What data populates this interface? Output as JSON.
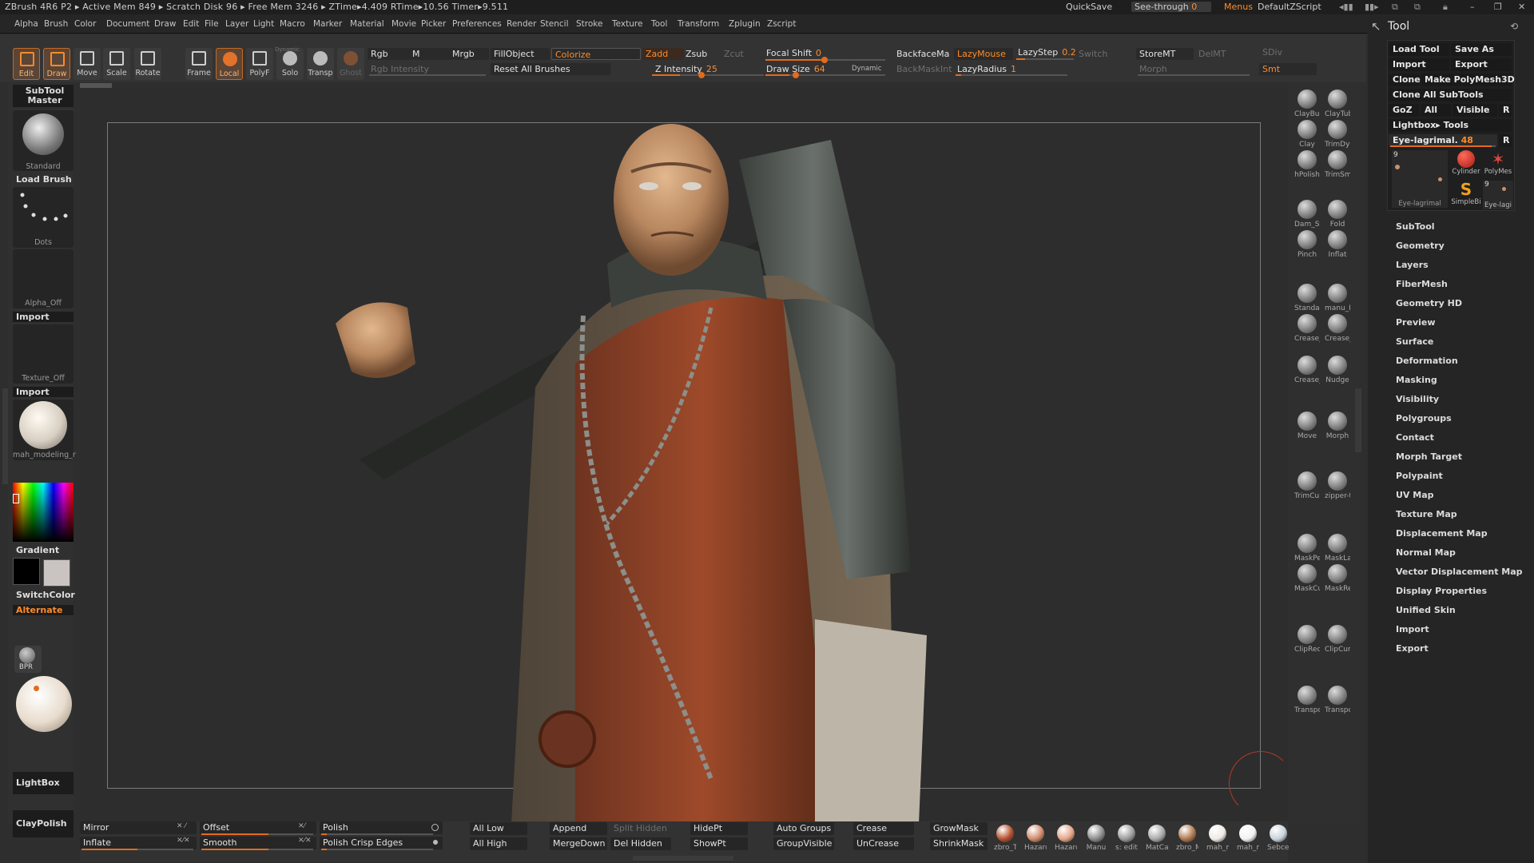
{
  "titlebar": {
    "title": "ZBrush 4R6 P2 ▸ Active Mem 849 ▸ Scratch Disk 96 ▸ Free Mem 3246 ▸ ZTime▸4.409 RTime▸10.56 Timer▸9.511",
    "quicksave": "QuickSave",
    "seethrough": "See-through",
    "seethrough_val": "0",
    "menus": "Menus",
    "script": "DefaultZScript"
  },
  "menubar": [
    "Alpha",
    "Brush",
    "Color",
    "Document",
    "Draw",
    "Edit",
    "File",
    "Layer",
    "Light",
    "Macro",
    "Marker",
    "Material",
    "Movie",
    "Picker",
    "Preferences",
    "Render",
    "Stencil",
    "Stroke",
    "Texture",
    "Tool",
    "Transform",
    "Zplugin",
    "Zscript"
  ],
  "topshelf": {
    "edit": "Edit",
    "draw": "Draw",
    "move": "Move",
    "scale": "Scale",
    "rotate": "Rotate",
    "frame": "Frame",
    "local": "Local",
    "polyf": "PolyF",
    "solo": "Solo",
    "transp": "Transp",
    "ghost": "Ghost",
    "dynamic_small": "Dynamic",
    "rgb": "Rgb",
    "m": "M",
    "mrgb": "Mrgb",
    "rgb_intensity": "Rgb Intensity",
    "fillobject": "FillObject",
    "colorize": "Colorize",
    "reset_brushes": "Reset All Brushes",
    "zadd": "Zadd",
    "zsub": "Zsub",
    "zcut": "Zcut",
    "z_intensity": "Z Intensity",
    "z_intensity_val": "25",
    "focal_shift": "Focal Shift",
    "focal_shift_val": "0",
    "draw_size": "Draw Size",
    "draw_size_val": "64",
    "dynamic": "Dynamic",
    "backface": "BackfaceMa",
    "backmask": "BackMaskInt",
    "lazymouse": "LazyMouse",
    "lazystep": "LazyStep",
    "lazystep_val": "0.2",
    "lazyradius": "LazyRadius",
    "lazyradius_val": "1",
    "switch": "Switch",
    "storemt": "StoreMT",
    "delmt": "DelMT",
    "morph": "Morph",
    "sdiv": "SDiv",
    "smt": "Smt"
  },
  "leftshelf": {
    "subtool_master": "SubTool Master",
    "brush_name": "Standard",
    "load_brush": "Load Brush",
    "stroke_name": "Dots",
    "alpha_name": "Alpha_Off",
    "import1": "Import",
    "texture_name": "Texture_Off",
    "import2": "Import",
    "material_name": "mah_modeling_r",
    "gradient": "Gradient",
    "switchcolor": "SwitchColor",
    "alternate": "Alternate",
    "bpr": "BPR",
    "lightbox": "LightBox",
    "claypolish": "ClayPolish"
  },
  "rightshelf": [
    {
      "label": "ClayBuil",
      "icon": "claybuildup-brush-icon"
    },
    {
      "label": "ClayTub",
      "icon": "claytubes-brush-icon"
    },
    {
      "label": "Clay",
      "icon": "clay-brush-icon"
    },
    {
      "label": "TrimDyn",
      "icon": "trimdynamic-brush-icon"
    },
    {
      "label": "hPolish",
      "icon": "hpolish-brush-icon"
    },
    {
      "label": "TrimSm",
      "icon": "trimsmooth-brush-icon"
    },
    {
      "label": "Dam_St",
      "icon": "damstandard-brush-icon"
    },
    {
      "label": "Fold",
      "icon": "fold-brush-icon"
    },
    {
      "label": "Pinch",
      "icon": "pinch-brush-icon"
    },
    {
      "label": "Inflat",
      "icon": "inflate-brush-icon"
    },
    {
      "label": "Standar",
      "icon": "standard-brush-icon"
    },
    {
      "label": "manu_Is",
      "icon": "manu-brush-icon"
    },
    {
      "label": "Crease_",
      "icon": "crease-brush-icon"
    },
    {
      "label": "Crease_",
      "icon": "crease-brush-icon"
    },
    {
      "label": "Crease_",
      "icon": "crease-brush-icon"
    },
    {
      "label": "Nudge",
      "icon": "nudge-brush-icon"
    },
    {
      "label": "Move",
      "icon": "move-brush-icon"
    },
    {
      "label": "Morph",
      "icon": "morph-brush-icon"
    },
    {
      "label": "TrimCur",
      "icon": "trimcurve-brush-icon"
    },
    {
      "label": "zipper-t",
      "icon": "zipper-brush-icon"
    },
    {
      "label": "MaskPei",
      "icon": "maskpen-brush-icon"
    },
    {
      "label": "MaskLas",
      "icon": "masklasso-brush-icon"
    },
    {
      "label": "MaskCui",
      "icon": "maskcurve-brush-icon"
    },
    {
      "label": "MaskRe",
      "icon": "maskrect-brush-icon"
    },
    {
      "label": "ClipRect",
      "icon": "cliprect-brush-icon"
    },
    {
      "label": "ClipCurv",
      "icon": "clipcurve-brush-icon"
    },
    {
      "label": "Transpo",
      "icon": "transpose-icon"
    },
    {
      "label": "Transpo",
      "icon": "transpose-icon"
    }
  ],
  "tool": {
    "title": "Tool",
    "load_tool": "Load Tool",
    "save_as": "Save As",
    "import": "Import",
    "export": "Export",
    "clone": "Clone",
    "make_polymesh": "Make PolyMesh3D",
    "clone_all": "Clone All SubTools",
    "goz": "GoZ",
    "all": "All",
    "visible": "Visible",
    "r": "R",
    "lightbox_tools": "Lightbox▸ Tools",
    "current": "Eye-lagrimal.",
    "current_val": "48",
    "thumb_count": "9",
    "thumbs": [
      "Eye-lagrimal",
      "Cylinder",
      "PolyMes",
      "SimpleBi",
      "Eye-lagi"
    ],
    "menu": [
      "SubTool",
      "Geometry",
      "Layers",
      "FiberMesh",
      "Geometry HD",
      "Preview",
      "Surface",
      "Deformation",
      "Masking",
      "Visibility",
      "Polygroups",
      "Contact",
      "Morph Target",
      "Polypaint",
      "UV Map",
      "Texture Map",
      "Displacement Map",
      "Normal Map",
      "Vector Displacement Map",
      "Display Properties",
      "Unified Skin",
      "Import",
      "Export"
    ]
  },
  "bottom": {
    "mirror": "Mirror",
    "inflate": "Inflate",
    "offset": "Offset",
    "smooth": "Smooth",
    "polish": "Polish",
    "polish_crisp": "Polish Crisp Edges",
    "all_low": "All Low",
    "all_high": "All High",
    "append": "Append",
    "mergedown": "MergeDown",
    "split_hidden": "Split Hidden",
    "del_hidden": "Del Hidden",
    "hidept": "HidePt",
    "showpt": "ShowPt",
    "auto_groups": "Auto Groups",
    "groupvisible": "GroupVisible",
    "crease": "Crease",
    "uncrease": "UnCrease",
    "growmask": "GrowMask",
    "shrinkmask": "ShrinkMask",
    "materials": [
      {
        "label": "zbro_Ti",
        "color": "#b5502e"
      },
      {
        "label": "Hazardo",
        "color": "#d08a6a"
      },
      {
        "label": "Hazardo",
        "color": "#e2a485"
      },
      {
        "label": "Manu",
        "color": "#8b8b8b"
      },
      {
        "label": "s: editMan",
        "color": "#9a9a9a"
      },
      {
        "label": "MatCap",
        "color": "#a8a8a8"
      },
      {
        "label": "zbro_M",
        "color": "#b07850"
      },
      {
        "label": "mah_m",
        "color": "#eeeae4"
      },
      {
        "label": "mah_m",
        "color": "#f2f2f2"
      },
      {
        "label": "Sebces",
        "color": "#c8d2da"
      }
    ]
  },
  "colors": {
    "accent": "#e26b1e",
    "panel": "#303030",
    "bg": "#2d2d2d"
  }
}
